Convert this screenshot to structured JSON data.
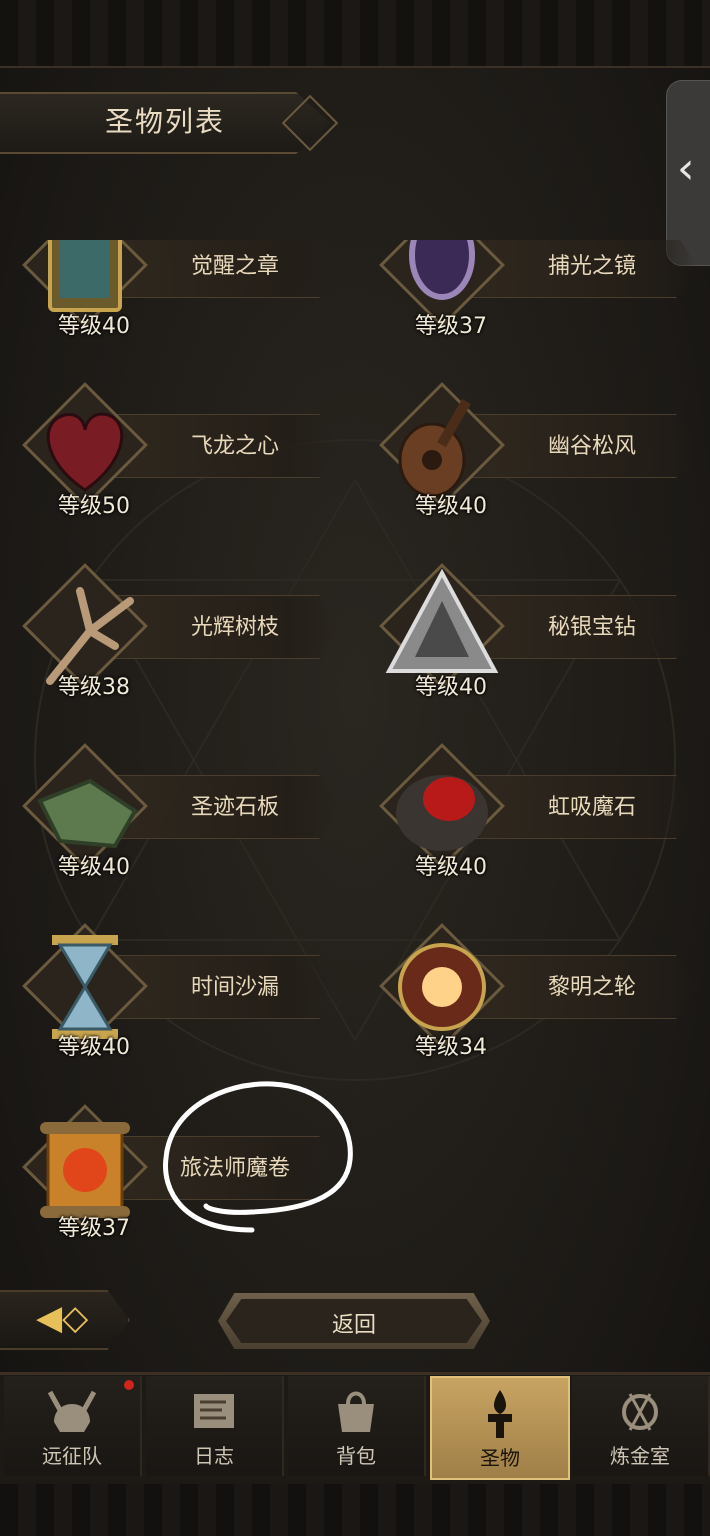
{
  "header": {
    "title": "圣物列表",
    "side_handle_icon": "chevron-left-icon"
  },
  "relics": [
    {
      "name": "觉醒之章",
      "level": "等级40",
      "icon": "book-icon"
    },
    {
      "name": "捕光之镜",
      "level": "等级37",
      "icon": "mirror-icon"
    },
    {
      "name": "飞龙之心",
      "level": "等级50",
      "icon": "dragon-heart-icon"
    },
    {
      "name": "幽谷松风",
      "level": "等级40",
      "icon": "lute-icon"
    },
    {
      "name": "光辉树枝",
      "level": "等级38",
      "icon": "branch-icon"
    },
    {
      "name": "秘银宝钻",
      "level": "等级40",
      "icon": "pyramid-gem-icon"
    },
    {
      "name": "圣迹石板",
      "level": "等级40",
      "icon": "stone-slab-icon"
    },
    {
      "name": "虹吸魔石",
      "level": "等级40",
      "icon": "red-stone-icon"
    },
    {
      "name": "时间沙漏",
      "level": "等级40",
      "icon": "hourglass-icon"
    },
    {
      "name": "黎明之轮",
      "level": "等级34",
      "icon": "dawn-wheel-icon"
    },
    {
      "name": "旅法师魔卷",
      "level": "等级37",
      "icon": "scroll-icon"
    }
  ],
  "actions": {
    "back_label": "返回",
    "arrow_icon": "arrow-left-icon"
  },
  "nav": [
    {
      "label": "远征队",
      "icon": "helmet-icon",
      "active": false,
      "badge": true
    },
    {
      "label": "日志",
      "icon": "map-icon",
      "active": false,
      "badge": false
    },
    {
      "label": "背包",
      "icon": "bag-icon",
      "active": false,
      "badge": false
    },
    {
      "label": "圣物",
      "icon": "torch-icon",
      "active": true,
      "badge": false
    },
    {
      "label": "炼金室",
      "icon": "alchemy-icon",
      "active": false,
      "badge": false
    }
  ],
  "colors": {
    "accent": "#c8a463",
    "text": "#e9d9bb",
    "badge": "#d0241e"
  }
}
